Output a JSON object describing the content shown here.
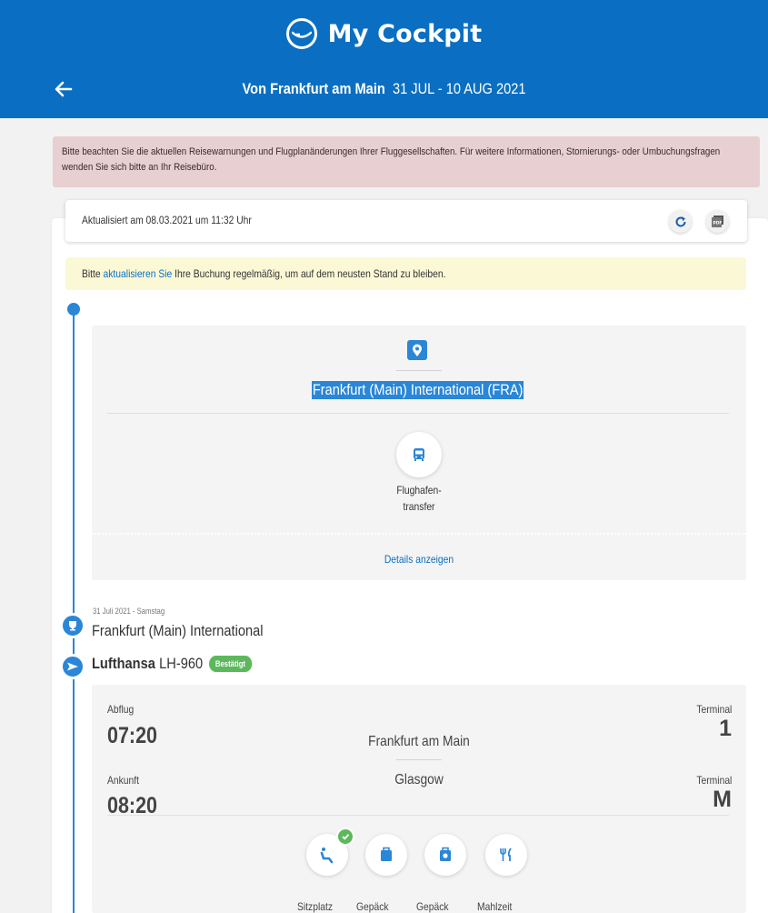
{
  "header": {
    "brand": "My Cockpit",
    "route_label": "Von Frankfurt am Main",
    "dates": "31 JUL - 10 AUG 2021"
  },
  "warning_text": "Bitte beachten Sie die aktuellen Reisewarnungen und Flugplanänderungen Ihrer Fluggesellschaften. Für weitere Informationen, Stornierungs- oder Umbuchungsfragen wenden Sie sich bitte an Ihr Reisebüro.",
  "updated_text": "Aktualisiert am 08.03.2021 um 11:32 Uhr",
  "notice": {
    "before": "Bitte ",
    "link": "aktualisieren Sie",
    "after": " Ihre Buchung regelmäßig, um auf dem neusten Stand zu bleiben."
  },
  "location": {
    "name": "Frankfurt (Main) International (FRA)",
    "service_line1": "Flughafen-",
    "service_line2": "transfer",
    "details_link": "Details anzeigen"
  },
  "flight": {
    "date": "31 Juli 2021 - Samstag",
    "airport": "Frankfurt (Main) International",
    "airline": "Lufthansa",
    "number": "LH-960",
    "status": "Bestätigt",
    "departure_label": "Abflug",
    "departure_time": "07:20",
    "departure_city": "Frankfurt am Main",
    "departure_terminal_label": "Terminal",
    "departure_terminal": "1",
    "arrival_label": "Ankunft",
    "arrival_time": "08:20",
    "arrival_city": "Glasgow",
    "arrival_terminal_label": "Terminal",
    "arrival_terminal": "M"
  },
  "service_labels": [
    "Sitzplatz",
    "Gepäck",
    "Gepäck",
    "Mahlzeit"
  ],
  "colors": {
    "brand_blue": "#0a6fc2",
    "timeline_blue": "#2a86d6",
    "warning_bg": "#e8cfd1",
    "notice_bg": "#fbf8d6",
    "confirmed_green": "#5cb85c"
  },
  "icons": {
    "brand": "smile-logo-icon",
    "back": "arrow-left-icon",
    "refresh": "refresh-icon",
    "pdf": "pdf-icon",
    "location": "map-pin-icon",
    "transfer": "bus-icon",
    "airport": "trophy-airport-icon",
    "flight": "plane-icon",
    "seat": "seat-icon",
    "baggage": "baggage-icon",
    "baggage2": "baggage-icon",
    "meal": "fork-knife-icon"
  }
}
